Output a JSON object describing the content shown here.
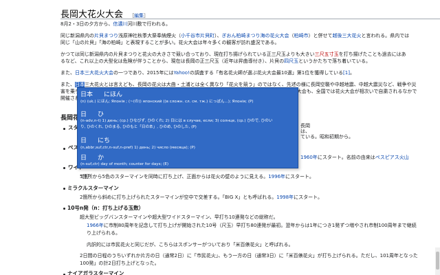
{
  "article": {
    "title": "長岡大花火大会",
    "edit_link": {
      "pre": "［",
      "label": "編集",
      "post": "］"
    },
    "p1": {
      "a": "8月2・3日の夕方から、",
      "b": "信濃川",
      "c": "河川敷で行われる。"
    },
    "p2": {
      "line1": {
        "a": "同じ新潟県内の",
        "b": "片貝まつり",
        "c": "浅原神社秋季大祭奉納煙火（",
        "d": "小千谷市片貝町",
        "e": "）、",
        "f": "ぎおん柏崎まつり海の花火大会",
        "g": "（",
        "h": "柏崎市",
        "i": "）と併せて",
        "j": "越後三大花火",
        "k": "と言われる。県内では"
      },
      "line2": "同じ「山の片貝」「海の柏崎」と表現することが多い。花火大会は年々多くの観客が訪れ盛況である。"
    },
    "p3": {
      "line1": {
        "a": "かつては同じ新潟県内の片貝まつりと花火の大きさで競い合っており、現在打ち揚げられている正三尺玉よりも大きい",
        "b": "三尺五寸玉",
        "c": "を打ち揚げたことも過去にはあ"
      },
      "line2": {
        "a": "るなど、これ以上の大型化は危険が伴うことから、現在は長岡の正三尺玉（近年は昇曲導付き）、片貝の",
        "b": "四尺玉",
        "c": "というかたちで落ち着いている。"
      }
    },
    "p4": {
      "a": "また、",
      "b": "日本三大花火大会",
      "c": "の一つであり、2015年には",
      "d": "Yahoo!",
      "e": "の調査する「有名花火師が選ぶ花火大会最10選」第1位を獲得している",
      "f": "[1]",
      "g": "。"
    },
    "p5": {
      "line1": {
        "a": "また、",
        "b": "日本",
        "c": "三大花火とは言えども、長岡の花火は大曲・土浦とは全く異なり「花火を競う」のではなく、先述の様に長岡空襲や中越地震、中越大震災など、戦争や災"
      },
      "line2": "害を乗り越えるための花火大会ということである。このため、東日本大震災発生した2011年8月の長岡大花火大会も、全国では花火大会が相次いで自粛されるなかで",
      "line3": "開催され、多くの観客が訪れた。"
    },
    "section": "長岡花火",
    "left_frag": {
      "a": "スタ",
      "b": "ター",
      "c": "ペス",
      "d": "基本",
      "e": "ワイド",
      "f": "て打"
    },
    "right_frag": {
      "a": "長岡",
      "b": "は、",
      "c": "ている。昭和初期から。",
      "d": "1960年",
      "e": "にスタート。名前の由来は",
      "f": "ペスピアス火山"
    },
    "wide": {
      "a": "5箇所から5色のスターマインを同時に打ち上げ、正面からは花火の壁のように見える。",
      "b": "1996年",
      "c": "にスタート。"
    },
    "miracle": {
      "title": "ミラクルスターマイン",
      "desc": {
        "a": "2箇所から斜めに打ち上げられたスターマインが空中で交差する。「BIG X」とも呼ばれる。",
        "b": "1998年",
        "c": "にスタート。"
      }
    },
    "no10": {
      "title": "10号n発（n：打ち上げる玉数）",
      "desc": "超大型ビッグバンスターマインや超大型ワイドスターマイン、早打ち10連発などの総称だ。",
      "sub1": {
        "a": "1966年",
        "b": "に市制80周年を記念して打ち上げが開始された10号（尺玉）早打ち80連発が最初。翌年からは1年につき1発ずつ増やされ市制100周年まで継続"
      },
      "sub1b": "り上げられる。",
      "sub2": "内訳的には市民花火と同じだが、こちらはスポンサーがついており「米百俵花火」と呼ばれる。"
    },
    "second_day": {
      "line1": "2日間の日程のうちいずれか片方の日（通常2日）に「市民花火」、もう一方の日（通常3日）に「米百俵花火」が打ち上げられる。ただし、101周年となった",
      "line2": "100発」の計2日打ち上げとなった。"
    },
    "last_item": "ナイアガラスターマイン"
  },
  "popup": {
    "entries": [
      {
        "headword": "日本",
        "reading": "にほん",
        "definition": "(n) (uk.) にほん; Японія ; (~(の)) японский ((в сложн. сл. см. тж.) にっぽん...); Японія; (P)"
      },
      {
        "headword": "日",
        "reading": "ひ",
        "definition": "(n-adv,n-t) 1) день; (cp.) ひなびず, ひのくれ; 2) 日には в случае, если; 3) солнце, (cp.) ひので, ひのい"
      },
      {
        "headword": "",
        "reading": "",
        "definition": "り, ひのくれ, ひのまる, ひのもと「日の本」, ひのめ, ひのした, (P)"
      },
      {
        "headword": "日",
        "reading": "にち",
        "definition": "(n,abbr,suf,ctr,n-suf,n-pref) 1) день; 2) число (месяца); (P)"
      },
      {
        "headword": "日",
        "reading": "か",
        "definition": "(n-suf,ctr) day of month; counter for days; (E)"
      }
    ]
  },
  "colors": {
    "link": "#0645ad",
    "highlight": "#316ac5",
    "redlink": "#ba0000"
  }
}
